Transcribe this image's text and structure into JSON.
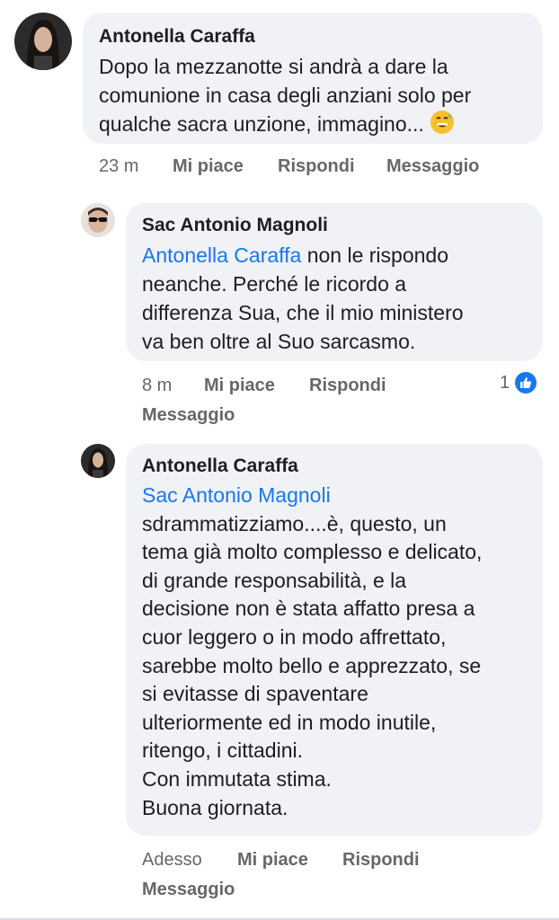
{
  "comments": [
    {
      "author": "Antonella Caraffa",
      "lines": [
        "Dopo la mezzanotte si andrà a dare la",
        "comunione in casa degli anziani solo per",
        "qualche sacra unzione, immagino..."
      ],
      "emoji": "grinning-sweat-emoji",
      "time": "23 m",
      "like": "Mi piace",
      "reply": "Rispondi",
      "message": "Messaggio"
    },
    {
      "author": "Sac Antonio Magnoli",
      "mention": "Antonella Caraffa",
      "first_line_rest": " non le rispondo",
      "lines": [
        "neanche. Perché le ricordo a",
        "differenza Sua, che il mio ministero",
        "va ben oltre al Suo sarcasmo."
      ],
      "time": "8 m",
      "like": "Mi piace",
      "reply": "Rispondi",
      "message": "Messaggio",
      "reaction_count": "1"
    },
    {
      "author": "Antonella Caraffa",
      "mention": "Sac Antonio Magnoli",
      "lines": [
        "sdrammatizziamo....è, questo, un",
        "tema già molto complesso e delicato,",
        "di grande responsabilità, e la",
        "decisione non è stata affatto presa a",
        "cuor leggero o in modo affrettato,",
        "sarebbe molto bello e apprezzato, se",
        "si evitasse di spaventare",
        "ulteriormente ed in modo inutile,",
        "ritengo, i cittadini.",
        "Con immutata stima.",
        "Buona giornata."
      ],
      "time": "Adesso",
      "like": "Mi piace",
      "reply": "Rispondi",
      "message": "Messaggio"
    }
  ]
}
